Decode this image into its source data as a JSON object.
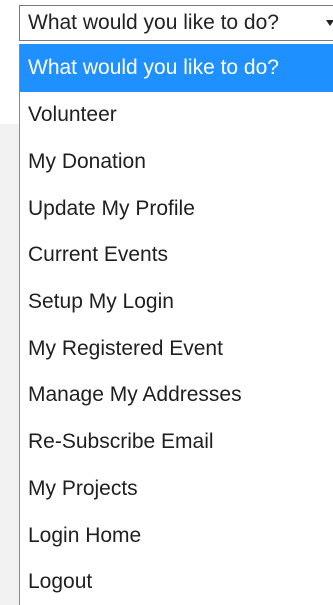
{
  "select": {
    "current_value": "What would you like to do?"
  },
  "options": [
    {
      "label": "What would you like to do?",
      "selected": true
    },
    {
      "label": "Volunteer"
    },
    {
      "label": "My Donation"
    },
    {
      "label": "Update My Profile"
    },
    {
      "label": "Current Events"
    },
    {
      "label": "Setup My Login"
    },
    {
      "label": "My Registered Event"
    },
    {
      "label": "Manage My Addresses"
    },
    {
      "label": "Re-Subscribe Email"
    },
    {
      "label": "My Projects"
    },
    {
      "label": "Login Home"
    },
    {
      "label": "Logout"
    }
  ],
  "colors": {
    "highlight": "#1e90ff",
    "text": "#1f1f1f",
    "selected_text": "#ffffff"
  }
}
